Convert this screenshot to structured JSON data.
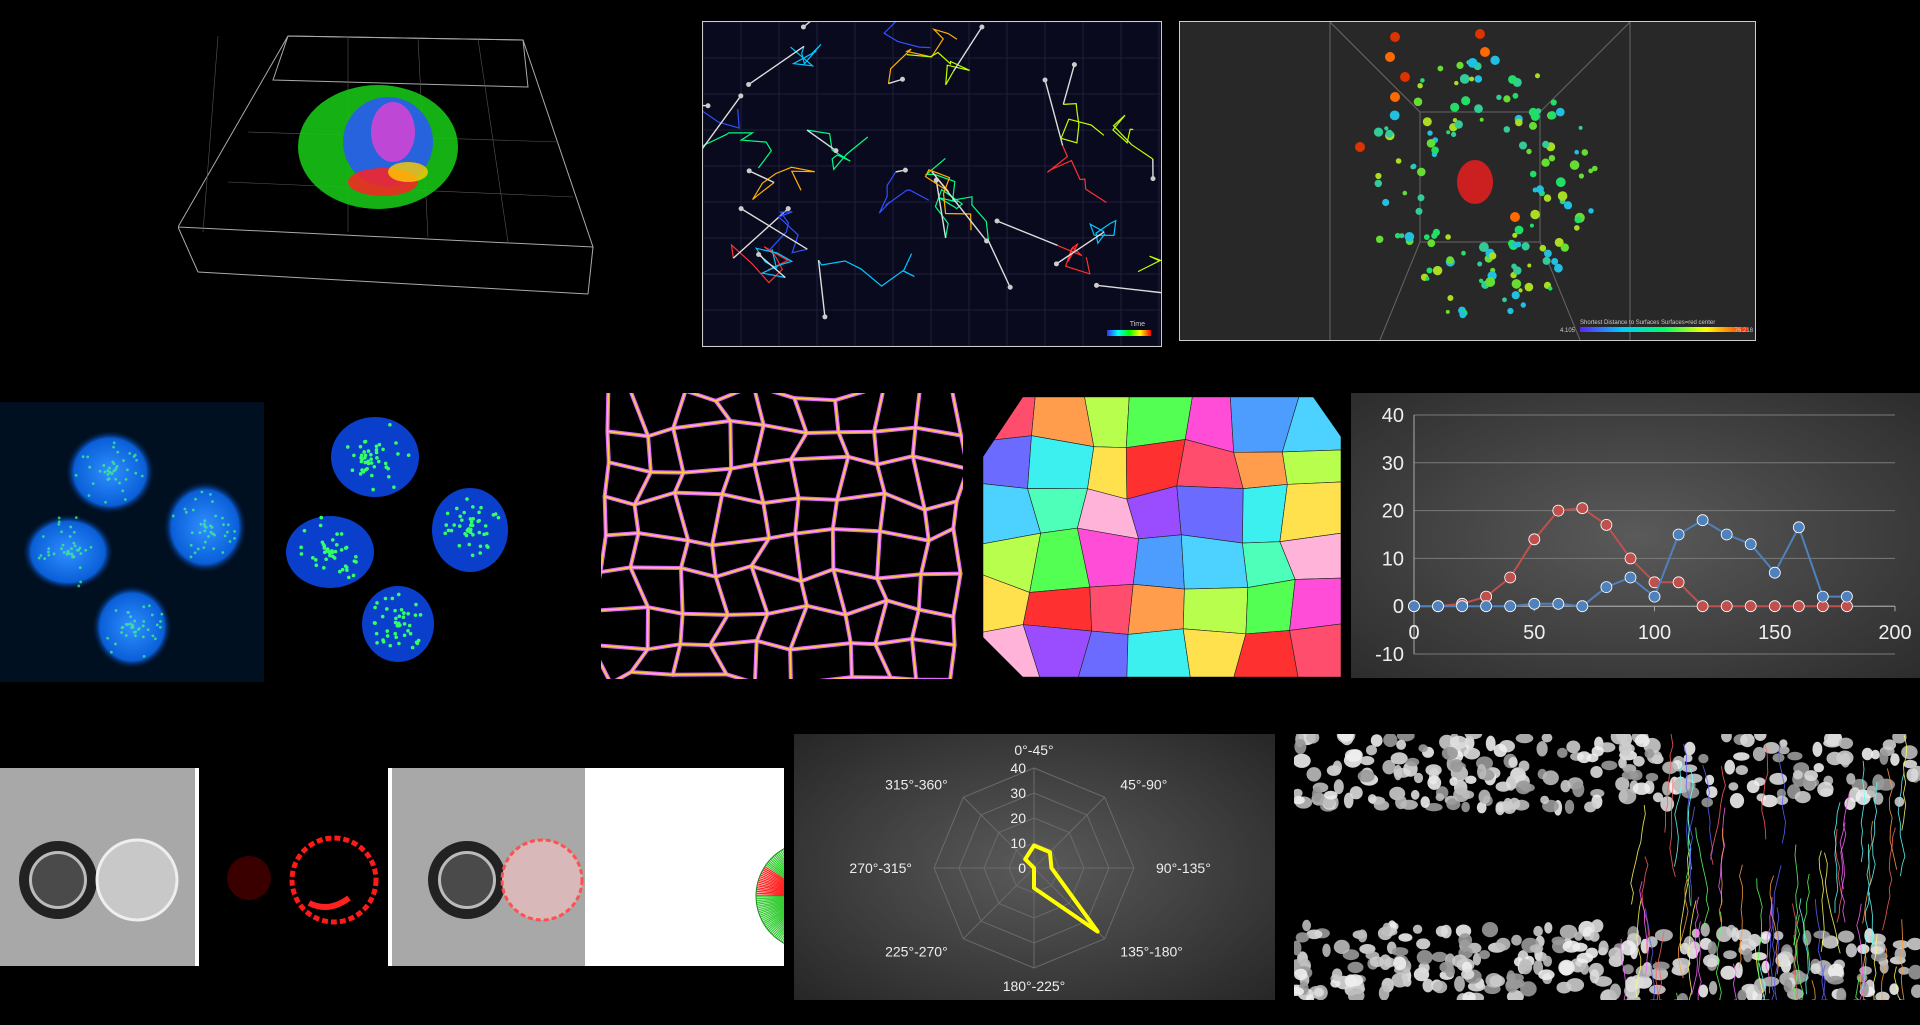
{
  "tracks_panel": {
    "colorbar_label": "Time"
  },
  "dist_panel": {
    "colorbar_label": "Shortest Distance to Surfaces Surfaces=red center",
    "colorbar_min": "4.105",
    "colorbar_max": "76.218"
  },
  "line_chart": {
    "chart_data": {
      "type": "line",
      "xlim": [
        0,
        200
      ],
      "ylim": [
        -10,
        40
      ],
      "x_ticks": [
        "0",
        "50",
        "100",
        "150",
        "200"
      ],
      "y_ticks": [
        "-10",
        "0",
        "10",
        "20",
        "30",
        "40"
      ],
      "grid": true,
      "series": [
        {
          "color": "#c0504d",
          "x": [
            0,
            10,
            20,
            30,
            40,
            50,
            60,
            70,
            80,
            90,
            100,
            110,
            120,
            130,
            140,
            150,
            160,
            170,
            180
          ],
          "y": [
            0,
            0,
            0.5,
            2,
            6,
            14,
            20,
            20.5,
            17,
            10,
            5,
            5,
            0,
            0,
            0,
            0,
            0,
            0,
            0
          ]
        },
        {
          "color": "#4f81bd",
          "x": [
            0,
            10,
            20,
            30,
            40,
            50,
            60,
            70,
            80,
            90,
            100,
            110,
            120,
            130,
            140,
            150,
            160,
            170,
            180
          ],
          "y": [
            0,
            0,
            0,
            0,
            0,
            0.5,
            0.5,
            0,
            4,
            6,
            2,
            15,
            18,
            15,
            13,
            7,
            16.5,
            2,
            2
          ]
        }
      ]
    }
  },
  "radar_chart": {
    "chart_data": {
      "type": "radar",
      "categories": [
        "0°-45°",
        "45°-90°",
        "90°-135°",
        "135°-180°",
        "180°-225°",
        "225°-270°",
        "270°-315°",
        "315°-360°"
      ],
      "values": [
        9,
        9,
        7,
        36,
        8,
        0,
        0,
        5
      ],
      "rlim": [
        0,
        40
      ],
      "r_ticks": [
        "0",
        "10",
        "20",
        "30",
        "40"
      ],
      "line_color": "#ffff00"
    }
  }
}
